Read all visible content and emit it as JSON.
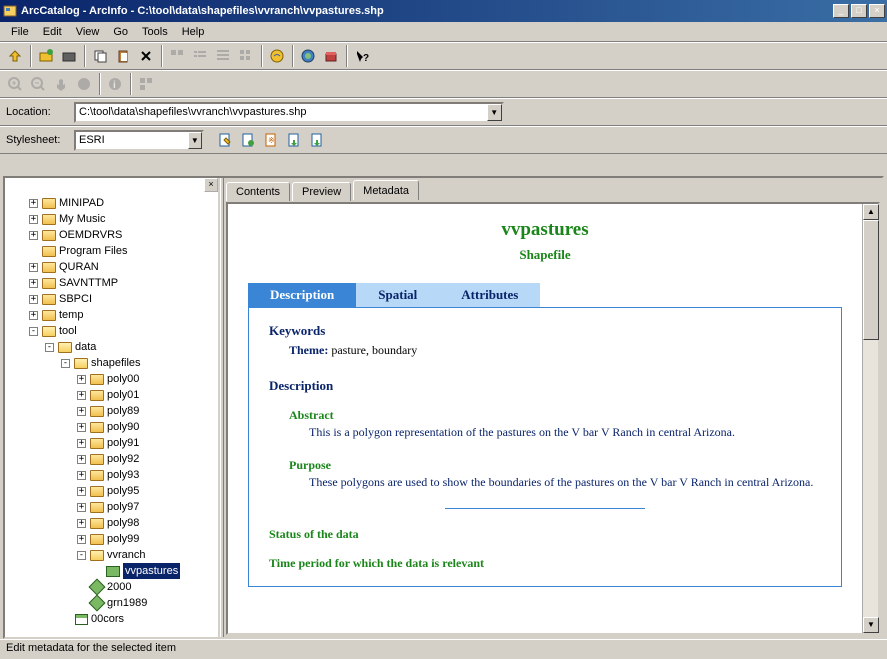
{
  "window": {
    "title": "ArcCatalog - ArcInfo - C:\\tool\\data\\shapefiles\\vvranch\\vvpastures.shp"
  },
  "menu": [
    "File",
    "Edit",
    "View",
    "Go",
    "Tools",
    "Help"
  ],
  "location": {
    "label": "Location:",
    "value": "C:\\tool\\data\\shapefiles\\vvranch\\vvpastures.shp"
  },
  "stylesheet": {
    "label": "Stylesheet:",
    "value": "ESRI"
  },
  "tree": [
    {
      "depth": 1,
      "pm": "+",
      "icon": "folder",
      "label": "MINIPAD"
    },
    {
      "depth": 1,
      "pm": "+",
      "icon": "folder",
      "label": "My Music"
    },
    {
      "depth": 1,
      "pm": "+",
      "icon": "folder",
      "label": "OEMDRVRS"
    },
    {
      "depth": 1,
      "pm": " ",
      "icon": "folder",
      "label": "Program Files"
    },
    {
      "depth": 1,
      "pm": "+",
      "icon": "folder",
      "label": "QURAN"
    },
    {
      "depth": 1,
      "pm": "+",
      "icon": "folder",
      "label": "SAVNTTMP"
    },
    {
      "depth": 1,
      "pm": "+",
      "icon": "folder",
      "label": "SBPCI"
    },
    {
      "depth": 1,
      "pm": "+",
      "icon": "folder",
      "label": "temp"
    },
    {
      "depth": 1,
      "pm": "-",
      "icon": "folder-open",
      "label": "tool"
    },
    {
      "depth": 2,
      "pm": "-",
      "icon": "folder-open",
      "label": "data"
    },
    {
      "depth": 3,
      "pm": "-",
      "icon": "folder-open",
      "label": "shapefiles"
    },
    {
      "depth": 4,
      "pm": "+",
      "icon": "folder",
      "label": "poly00"
    },
    {
      "depth": 4,
      "pm": "+",
      "icon": "folder",
      "label": "poly01"
    },
    {
      "depth": 4,
      "pm": "+",
      "icon": "folder",
      "label": "poly89"
    },
    {
      "depth": 4,
      "pm": "+",
      "icon": "folder",
      "label": "poly90"
    },
    {
      "depth": 4,
      "pm": "+",
      "icon": "folder",
      "label": "poly91"
    },
    {
      "depth": 4,
      "pm": "+",
      "icon": "folder",
      "label": "poly92"
    },
    {
      "depth": 4,
      "pm": "+",
      "icon": "folder",
      "label": "poly93"
    },
    {
      "depth": 4,
      "pm": "+",
      "icon": "folder",
      "label": "poly95"
    },
    {
      "depth": 4,
      "pm": "+",
      "icon": "folder",
      "label": "poly97"
    },
    {
      "depth": 4,
      "pm": "+",
      "icon": "folder",
      "label": "poly98"
    },
    {
      "depth": 4,
      "pm": "+",
      "icon": "folder",
      "label": "poly99"
    },
    {
      "depth": 4,
      "pm": "-",
      "icon": "folder-open",
      "label": "vvranch"
    },
    {
      "depth": 5,
      "pm": " ",
      "icon": "shp",
      "label": "vvpastures",
      "selected": true
    },
    {
      "depth": 4,
      "pm": " ",
      "icon": "shp2",
      "label": "2000"
    },
    {
      "depth": 4,
      "pm": " ",
      "icon": "shp2",
      "label": "grn1989"
    },
    {
      "depth": 3,
      "pm": " ",
      "icon": "tbl",
      "label": "00cors"
    }
  ],
  "tabs": {
    "contents": "Contents",
    "preview": "Preview",
    "metadata": "Metadata"
  },
  "metadata": {
    "title": "vvpastures",
    "subtitle": "Shapefile",
    "subtabs": {
      "description": "Description",
      "spatial": "Spatial",
      "attributes": "Attributes"
    },
    "keywords_h": "Keywords",
    "theme_label": "Theme:",
    "theme_val": "pasture, boundary",
    "description_h": "Description",
    "abstract_h": "Abstract",
    "abstract_txt": "This is a polygon representation of the pastures on the V bar V Ranch in central Arizona.",
    "purpose_h": "Purpose",
    "purpose_txt": "These polygons are used to show the boundaries of the pastures on the V bar V Ranch in central Arizona.",
    "status_h": "Status of the data",
    "timeperiod_h": "Time period for which the data is relevant"
  },
  "statusbar": "Edit metadata for the selected item"
}
